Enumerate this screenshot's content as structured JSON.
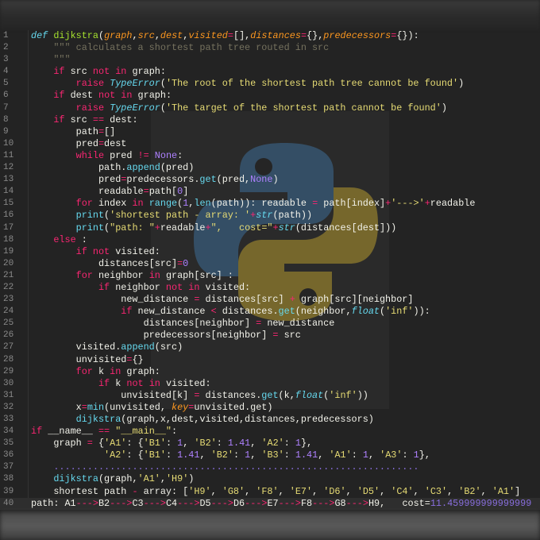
{
  "editor": {
    "theme_colors": {
      "keyword": "#f92672",
      "function": "#a6e22e",
      "param": "#fd971f",
      "string": "#e6db74",
      "number": "#ae81ff",
      "builtin": "#66d9ef",
      "comment": "#75715e",
      "background": "#232323"
    },
    "watermark_icon": "python-logo-icon",
    "highlighted_line": 40,
    "lines": [
      [
        [
          "dk",
          "def "
        ],
        [
          "f",
          "dijkstra"
        ],
        [
          "p",
          "("
        ],
        [
          "a",
          "graph"
        ],
        [
          "p",
          ","
        ],
        [
          "a",
          "src"
        ],
        [
          "p",
          ","
        ],
        [
          "a",
          "dest"
        ],
        [
          "p",
          ","
        ],
        [
          "a",
          "visited"
        ],
        [
          "o",
          "="
        ],
        [
          "p",
          "[],"
        ],
        [
          "a",
          "distances"
        ],
        [
          "o",
          "="
        ],
        [
          "p",
          "{},"
        ],
        [
          "a",
          "predecessors"
        ],
        [
          "o",
          "="
        ],
        [
          "p",
          "{}):"
        ]
      ],
      [
        [
          "p",
          "    "
        ],
        [
          "m",
          "\"\"\" calculates a shortest path tree routed in src"
        ]
      ],
      [
        [
          "p",
          "    "
        ],
        [
          "m",
          "\"\"\""
        ]
      ],
      [
        [
          "p",
          "    "
        ],
        [
          "k",
          "if "
        ],
        [
          "p",
          "src "
        ],
        [
          "k",
          "not in "
        ],
        [
          "p",
          "graph:"
        ]
      ],
      [
        [
          "p",
          "        "
        ],
        [
          "k",
          "raise "
        ],
        [
          "c",
          "TypeError"
        ],
        [
          "p",
          "("
        ],
        [
          "s",
          "'The root of the shortest path tree cannot be found'"
        ],
        [
          "p",
          ")"
        ]
      ],
      [
        [
          "p",
          "    "
        ],
        [
          "k",
          "if "
        ],
        [
          "p",
          "dest "
        ],
        [
          "k",
          "not in "
        ],
        [
          "p",
          "graph:"
        ]
      ],
      [
        [
          "p",
          "        "
        ],
        [
          "k",
          "raise "
        ],
        [
          "c",
          "TypeError"
        ],
        [
          "p",
          "("
        ],
        [
          "s",
          "'The target of the shortest path cannot be found'"
        ],
        [
          "p",
          ")"
        ]
      ],
      [
        [
          "p",
          "    "
        ],
        [
          "k",
          "if "
        ],
        [
          "p",
          "src "
        ],
        [
          "o",
          "== "
        ],
        [
          "p",
          "dest:"
        ]
      ],
      [
        [
          "p",
          "        path"
        ],
        [
          "o",
          "="
        ],
        [
          "p",
          "[]"
        ]
      ],
      [
        [
          "p",
          "        pred"
        ],
        [
          "o",
          "="
        ],
        [
          "p",
          "dest"
        ]
      ],
      [
        [
          "p",
          "        "
        ],
        [
          "k",
          "while "
        ],
        [
          "p",
          "pred "
        ],
        [
          "o",
          "!= "
        ],
        [
          "n",
          "None"
        ],
        [
          "p",
          ":"
        ]
      ],
      [
        [
          "p",
          "            path."
        ],
        [
          "b",
          "append"
        ],
        [
          "p",
          "(pred)"
        ]
      ],
      [
        [
          "p",
          "            pred"
        ],
        [
          "o",
          "="
        ],
        [
          "p",
          "predecessors."
        ],
        [
          "b",
          "get"
        ],
        [
          "p",
          "(pred,"
        ],
        [
          "n",
          "None"
        ],
        [
          "p",
          ")"
        ]
      ],
      [
        [
          "p",
          "            readable"
        ],
        [
          "o",
          "="
        ],
        [
          "p",
          "path["
        ],
        [
          "n",
          "0"
        ],
        [
          "p",
          "]"
        ]
      ],
      [
        [
          "p",
          "        "
        ],
        [
          "k",
          "for "
        ],
        [
          "p",
          "index "
        ],
        [
          "k",
          "in "
        ],
        [
          "b",
          "range"
        ],
        [
          "p",
          "("
        ],
        [
          "n",
          "1"
        ],
        [
          "p",
          ","
        ],
        [
          "b",
          "len"
        ],
        [
          "p",
          "(path)): readable "
        ],
        [
          "o",
          "= "
        ],
        [
          "p",
          "path[index]"
        ],
        [
          "o",
          "+"
        ],
        [
          "s",
          "'--->'"
        ],
        [
          "o",
          "+"
        ],
        [
          "p",
          "readable"
        ]
      ],
      [
        [
          "p",
          "        "
        ],
        [
          "b",
          "print"
        ],
        [
          "p",
          "("
        ],
        [
          "s",
          "'shortest path - array: '"
        ],
        [
          "o",
          "+"
        ],
        [
          "c",
          "str"
        ],
        [
          "p",
          "(path))"
        ]
      ],
      [
        [
          "p",
          "        "
        ],
        [
          "b",
          "print"
        ],
        [
          "p",
          "("
        ],
        [
          "s",
          "\"path: \""
        ],
        [
          "o",
          "+"
        ],
        [
          "p",
          "readable"
        ],
        [
          "o",
          "+"
        ],
        [
          "s",
          "\",   cost=\""
        ],
        [
          "o",
          "+"
        ],
        [
          "c",
          "str"
        ],
        [
          "p",
          "(distances[dest]))"
        ]
      ],
      [
        [
          "p",
          "    "
        ],
        [
          "k",
          "else "
        ],
        [
          "p",
          ":"
        ]
      ],
      [
        [
          "p",
          "        "
        ],
        [
          "k",
          "if not "
        ],
        [
          "p",
          "visited:"
        ]
      ],
      [
        [
          "p",
          "            distances[src]"
        ],
        [
          "o",
          "="
        ],
        [
          "n",
          "0"
        ]
      ],
      [
        [
          "p",
          "        "
        ],
        [
          "k",
          "for "
        ],
        [
          "p",
          "neighbor "
        ],
        [
          "k",
          "in "
        ],
        [
          "p",
          "graph[src] :"
        ]
      ],
      [
        [
          "p",
          "            "
        ],
        [
          "k",
          "if "
        ],
        [
          "p",
          "neighbor "
        ],
        [
          "k",
          "not in "
        ],
        [
          "p",
          "visited:"
        ]
      ],
      [
        [
          "p",
          "                new_distance "
        ],
        [
          "o",
          "= "
        ],
        [
          "p",
          "distances[src] "
        ],
        [
          "o",
          "+ "
        ],
        [
          "p",
          "graph[src][neighbor]"
        ]
      ],
      [
        [
          "p",
          "                "
        ],
        [
          "k",
          "if "
        ],
        [
          "p",
          "new_distance "
        ],
        [
          "o",
          "< "
        ],
        [
          "p",
          "distances."
        ],
        [
          "b",
          "get"
        ],
        [
          "p",
          "(neighbor,"
        ],
        [
          "c",
          "float"
        ],
        [
          "p",
          "("
        ],
        [
          "s",
          "'inf'"
        ],
        [
          "p",
          "))"
        ],
        [
          "p",
          ":"
        ]
      ],
      [
        [
          "p",
          "                    distances[neighbor] "
        ],
        [
          "o",
          "= "
        ],
        [
          "p",
          "new_distance"
        ]
      ],
      [
        [
          "p",
          "                    predecessors[neighbor] "
        ],
        [
          "o",
          "= "
        ],
        [
          "p",
          "src"
        ]
      ],
      [
        [
          "p",
          "        visited."
        ],
        [
          "b",
          "append"
        ],
        [
          "p",
          "(src)"
        ]
      ],
      [
        [
          "p",
          "        unvisited"
        ],
        [
          "o",
          "="
        ],
        [
          "p",
          "{}"
        ]
      ],
      [
        [
          "p",
          "        "
        ],
        [
          "k",
          "for "
        ],
        [
          "p",
          "k "
        ],
        [
          "k",
          "in "
        ],
        [
          "p",
          "graph:"
        ]
      ],
      [
        [
          "p",
          "            "
        ],
        [
          "k",
          "if "
        ],
        [
          "p",
          "k "
        ],
        [
          "k",
          "not in "
        ],
        [
          "p",
          "visited:"
        ]
      ],
      [
        [
          "p",
          "                unvisited[k] "
        ],
        [
          "o",
          "= "
        ],
        [
          "p",
          "distances."
        ],
        [
          "b",
          "get"
        ],
        [
          "p",
          "(k,"
        ],
        [
          "c",
          "float"
        ],
        [
          "p",
          "("
        ],
        [
          "s",
          "'inf'"
        ],
        [
          "p",
          "))"
        ]
      ],
      [
        [
          "p",
          "        x"
        ],
        [
          "o",
          "="
        ],
        [
          "b",
          "min"
        ],
        [
          "p",
          "(unvisited, "
        ],
        [
          "a",
          "key"
        ],
        [
          "o",
          "="
        ],
        [
          "p",
          "unvisited.get)"
        ]
      ],
      [
        [
          "p",
          "        "
        ],
        [
          "b",
          "dijkstra"
        ],
        [
          "p",
          "(graph,x,dest,visited,distances,predecessors)"
        ]
      ],
      [
        [
          "k",
          "if "
        ],
        [
          "p",
          "__name__ "
        ],
        [
          "o",
          "== "
        ],
        [
          "s",
          "\"__main__\""
        ],
        [
          "p",
          ":"
        ]
      ],
      [
        [
          "p",
          "    graph "
        ],
        [
          "o",
          "= "
        ],
        [
          "p",
          "{"
        ],
        [
          "s",
          "'A1'"
        ],
        [
          "p",
          ": {"
        ],
        [
          "s",
          "'B1'"
        ],
        [
          "p",
          ": "
        ],
        [
          "n",
          "1"
        ],
        [
          "p",
          ", "
        ],
        [
          "s",
          "'B2'"
        ],
        [
          "p",
          ": "
        ],
        [
          "n",
          "1.41"
        ],
        [
          "p",
          ", "
        ],
        [
          "s",
          "'A2'"
        ],
        [
          "p",
          ": "
        ],
        [
          "n",
          "1"
        ],
        [
          "p",
          "},"
        ]
      ],
      [
        [
          "p",
          "             "
        ],
        [
          "s",
          "'A2'"
        ],
        [
          "p",
          ": {"
        ],
        [
          "s",
          "'B1'"
        ],
        [
          "p",
          ": "
        ],
        [
          "n",
          "1.41"
        ],
        [
          "p",
          ", "
        ],
        [
          "s",
          "'B2'"
        ],
        [
          "p",
          ": "
        ],
        [
          "n",
          "1"
        ],
        [
          "p",
          ", "
        ],
        [
          "s",
          "'B3'"
        ],
        [
          "p",
          ": "
        ],
        [
          "n",
          "1.41"
        ],
        [
          "p",
          ", "
        ],
        [
          "s",
          "'A1'"
        ],
        [
          "p",
          ": "
        ],
        [
          "n",
          "1"
        ],
        [
          "p",
          ", "
        ],
        [
          "s",
          "'A3'"
        ],
        [
          "p",
          ": "
        ],
        [
          "n",
          "1"
        ],
        [
          "p",
          "},"
        ]
      ],
      [
        [
          "p",
          "    "
        ],
        [
          "d",
          "................................................................."
        ]
      ],
      [
        [
          "p",
          "    "
        ],
        [
          "b",
          "dijkstra"
        ],
        [
          "p",
          "(graph,"
        ],
        [
          "s",
          "'A1'"
        ],
        [
          "p",
          ","
        ],
        [
          "s",
          "'H9'"
        ],
        [
          "p",
          ")"
        ]
      ],
      [
        [
          "p",
          "    shortest path "
        ],
        [
          "o",
          "- "
        ],
        [
          "p",
          "array: ["
        ],
        [
          "s",
          "'H9'"
        ],
        [
          "p",
          ", "
        ],
        [
          "s",
          "'G8'"
        ],
        [
          "p",
          ", "
        ],
        [
          "s",
          "'F8'"
        ],
        [
          "p",
          ", "
        ],
        [
          "s",
          "'E7'"
        ],
        [
          "p",
          ", "
        ],
        [
          "s",
          "'D6'"
        ],
        [
          "p",
          ", "
        ],
        [
          "s",
          "'D5'"
        ],
        [
          "p",
          ", "
        ],
        [
          "s",
          "'C4'"
        ],
        [
          "p",
          ", "
        ],
        [
          "s",
          "'C3'"
        ],
        [
          "p",
          ", "
        ],
        [
          "s",
          "'B2'"
        ],
        [
          "p",
          ", "
        ],
        [
          "s",
          "'A1'"
        ],
        [
          "p",
          "]"
        ]
      ],
      [
        [
          "p",
          "path: A1"
        ],
        [
          "o",
          "--->"
        ],
        [
          "p",
          "B2"
        ],
        [
          "o",
          "--->"
        ],
        [
          "p",
          "C3"
        ],
        [
          "o",
          "--->"
        ],
        [
          "p",
          "C4"
        ],
        [
          "o",
          "--->"
        ],
        [
          "p",
          "D5"
        ],
        [
          "o",
          "--->"
        ],
        [
          "p",
          "D6"
        ],
        [
          "o",
          "--->"
        ],
        [
          "p",
          "E7"
        ],
        [
          "o",
          "--->"
        ],
        [
          "p",
          "F8"
        ],
        [
          "o",
          "--->"
        ],
        [
          "p",
          "G8"
        ],
        [
          "o",
          "--->"
        ],
        [
          "p",
          "H9,   cost="
        ],
        [
          "d",
          "11.459999999999999"
        ]
      ]
    ]
  }
}
